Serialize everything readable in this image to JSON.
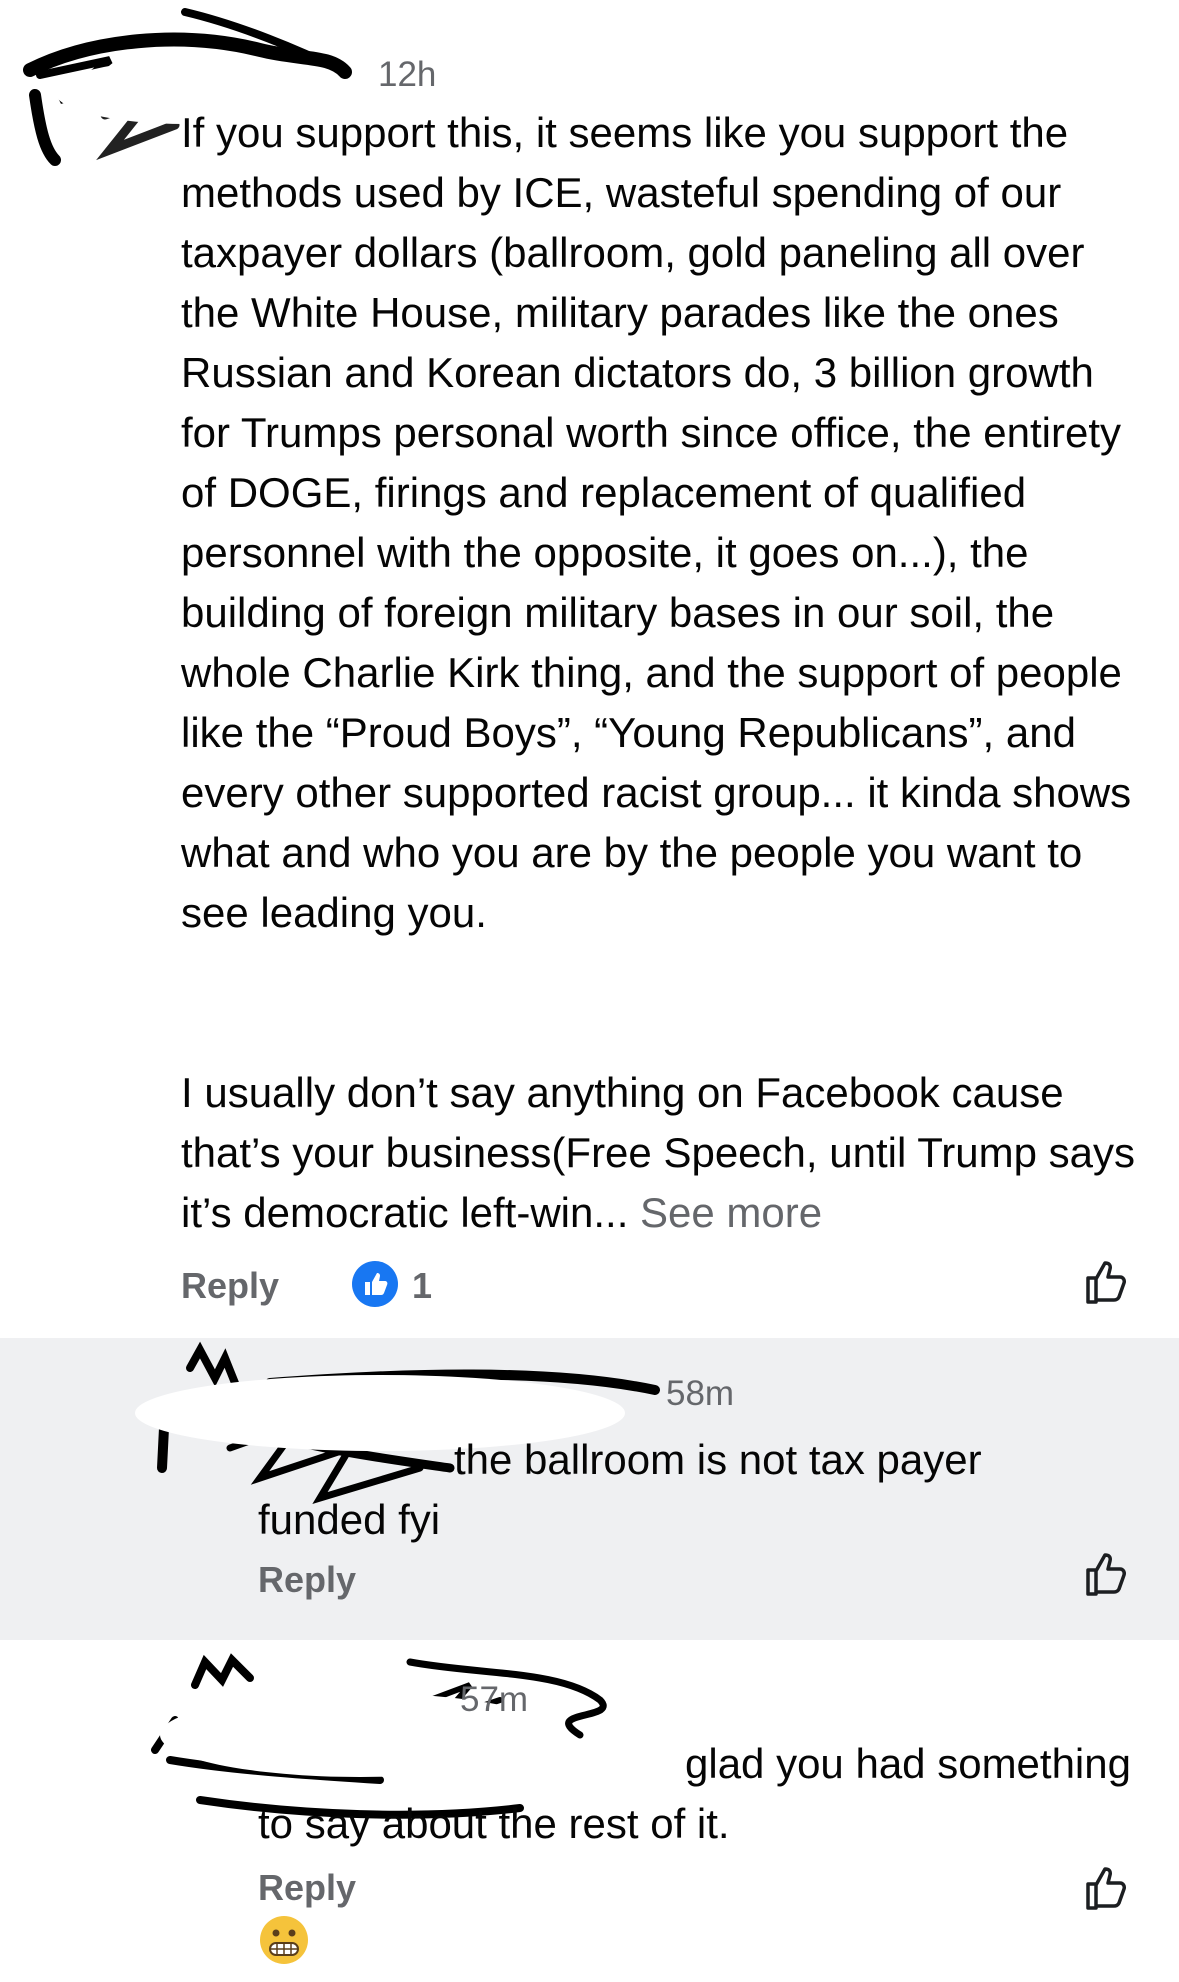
{
  "comments": [
    {
      "time": "12h",
      "text": "If you support this, it seems like you support the methods used by ICE, wasteful spending of our taxpayer dollars (ballroom, gold paneling all over the White House, military parades like the ones Russian and Korean dictators do, 3 billion growth for Trumps personal worth since office, the entirety of DOGE, firings and replacement of qualified personnel with the opposite, it goes on...), the building of foreign military bases in our soil, the whole Charlie Kirk thing, and the support of people like the “Proud Boys”, “Young Republicans”, and every other supported racist group... it kinda shows what and who you are by the people you want to see leading you.",
      "text2": "I usually don’t say anything on Facebook cause that’s your business(Free Speech, until Trump says it’s democratic left-win...",
      "see_more": "See more",
      "reply": "Reply",
      "reaction_count": "1",
      "reaction_icon": "thumbs-up-icon"
    },
    {
      "time": "58m",
      "text": "the ballroom is not tax payer funded fyi",
      "reply": "Reply"
    },
    {
      "time": "57m",
      "text": "glad you had something to say about the rest of it.",
      "emoji": "grimacing-face-emoji",
      "reply": "Reply"
    }
  ],
  "colors": {
    "accent": "#1877f2",
    "secondary_text": "#65676b",
    "highlight_bg": "#eff0f2"
  }
}
